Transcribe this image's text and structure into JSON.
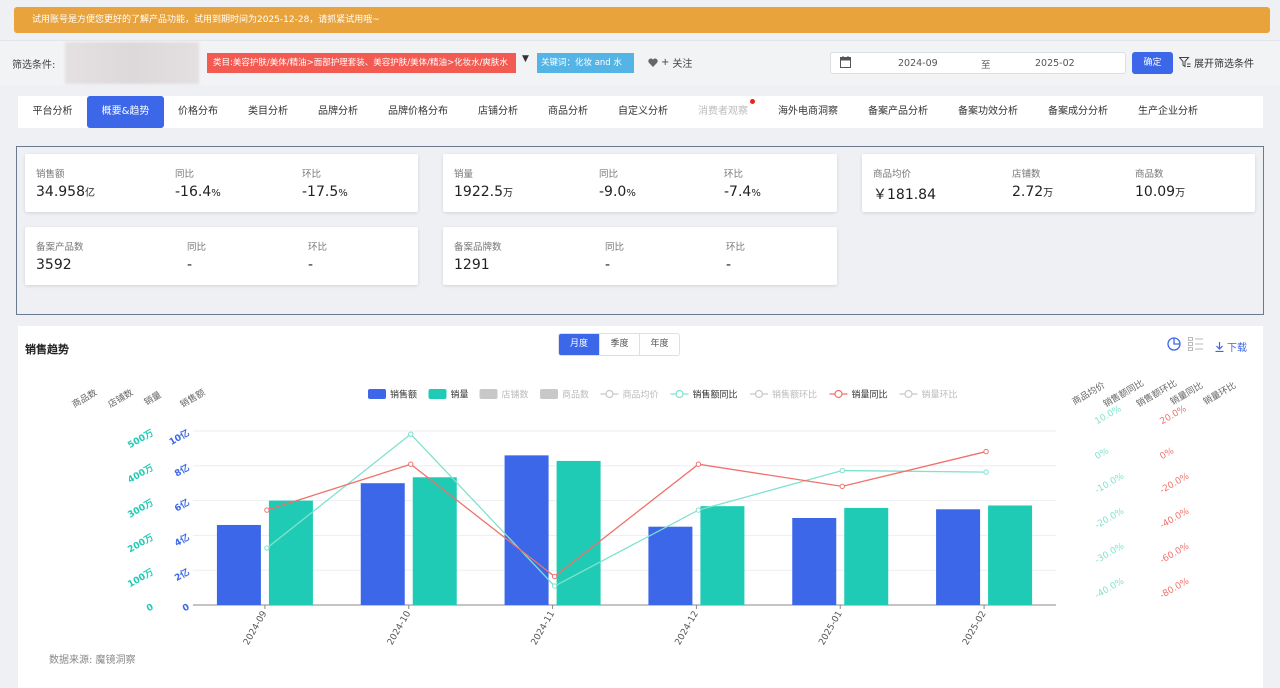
{
  "banner": {
    "text": "试用账号是方便您更好的了解产品功能，试用到期时间为2025-12-28，请抓紧试用哦~"
  },
  "filter": {
    "label": "筛选条件:",
    "category_tag": "类目:美容护肤/美体/精油>面部护理套装、美容护肤/美体/精油>化妆水/爽肤水",
    "keyword_tag": "关键词：化妆 and 水",
    "follow": "关注",
    "date_start": "2024-09",
    "date_sep": "至",
    "date_end": "2025-02",
    "confirm": "确定",
    "expand": "展开筛选条件"
  },
  "tabs": [
    "平台分析",
    "概要&趋势",
    "价格分布",
    "类目分析",
    "品牌分析",
    "品牌价格分布",
    "店铺分析",
    "商品分析",
    "自定义分析",
    "消费者观察",
    "海外电商洞察",
    "备案产品分析",
    "备案功效分析",
    "备案成分分析",
    "生产企业分析"
  ],
  "active_tab": "概要&趋势",
  "kpi": {
    "sales_amount": {
      "label": "销售额",
      "value": "34.958",
      "unit": "亿"
    },
    "sales_amount_yoy": {
      "label": "同比",
      "value": "-16.4",
      "unit": "%"
    },
    "sales_amount_mom": {
      "label": "环比",
      "value": "-17.5",
      "unit": "%"
    },
    "sales_volume": {
      "label": "销量",
      "value": "1922.5",
      "unit": "万"
    },
    "sales_volume_yoy": {
      "label": "同比",
      "value": "-9.0",
      "unit": "%"
    },
    "sales_volume_mom": {
      "label": "环比",
      "value": "-7.4",
      "unit": "%"
    },
    "avg_price": {
      "label": "商品均价",
      "value": "￥181.84",
      "unit": ""
    },
    "shops": {
      "label": "店铺数",
      "value": "2.72",
      "unit": "万"
    },
    "products": {
      "label": "商品数",
      "value": "10.09",
      "unit": "万"
    },
    "filed_products": {
      "label": "备案产品数",
      "value": "3592",
      "unit": ""
    },
    "filed_products_yoy": {
      "label": "同比",
      "value": "-",
      "unit": ""
    },
    "filed_products_mom": {
      "label": "环比",
      "value": "-",
      "unit": ""
    },
    "filed_brands": {
      "label": "备案品牌数",
      "value": "1291",
      "unit": ""
    },
    "filed_brands_yoy": {
      "label": "同比",
      "value": "-",
      "unit": ""
    },
    "filed_brands_mom": {
      "label": "环比",
      "value": "-",
      "unit": ""
    }
  },
  "chart_section": {
    "title": "销售趋势",
    "periods": [
      "月度",
      "季度",
      "年度"
    ],
    "active_period": "月度",
    "download": "下载",
    "source": "数据来源: 魔镜洞察"
  },
  "colors": {
    "blue": "#3b67e8",
    "teal": "#20cbb5",
    "red": "#f0716b",
    "mint": "#7fe2cf",
    "grey": "#c8c8c8",
    "accent": "#3b67e8",
    "banner": "#e8a33d"
  },
  "chart_data": {
    "type": "bar",
    "categories": [
      "2024-09",
      "2024-10",
      "2024-11",
      "2024-12",
      "2025-01",
      "2025-02"
    ],
    "legend": [
      {
        "name": "销售额",
        "kind": "bar",
        "color": "#3b67e8",
        "active": true
      },
      {
        "name": "销量",
        "kind": "bar",
        "color": "#20cbb5",
        "active": true
      },
      {
        "name": "店铺数",
        "kind": "bar",
        "color": "#c8c8c8",
        "active": false
      },
      {
        "name": "商品数",
        "kind": "bar",
        "color": "#c8c8c8",
        "active": false
      },
      {
        "name": "商品均价",
        "kind": "line",
        "color": "#c8c8c8",
        "active": false
      },
      {
        "name": "销售额同比",
        "kind": "line",
        "color": "#7fe2cf",
        "active": true
      },
      {
        "name": "销售额环比",
        "kind": "line",
        "color": "#c8c8c8",
        "active": false
      },
      {
        "name": "销量同比",
        "kind": "line",
        "color": "#f0716b",
        "active": true
      },
      {
        "name": "销量环比",
        "kind": "line",
        "color": "#c8c8c8",
        "active": false
      }
    ],
    "left_axis_titles": [
      "商品数",
      "店铺数",
      "销量",
      "销售额"
    ],
    "right_axis_titles": [
      "商品均价",
      "销售额同比",
      "销售额环比",
      "销量同比",
      "销量环比"
    ],
    "series": [
      {
        "name": "销售额",
        "unit": "亿",
        "axis": "sales",
        "values": [
          4.6,
          7.0,
          8.6,
          4.5,
          5.0,
          5.5
        ]
      },
      {
        "name": "销量",
        "unit": "万",
        "axis": "volume",
        "values": [
          300,
          367,
          414,
          284,
          279,
          286
        ]
      },
      {
        "name": "销售额同比",
        "unit": "%",
        "axis": "yoy_amount",
        "values": [
          -27,
          9,
          -39,
          -15,
          -2.5,
          -3
        ]
      },
      {
        "name": "销量同比",
        "unit": "%",
        "axis": "yoy_volume",
        "values": [
          -30,
          -1,
          -72,
          -1,
          -15,
          7
        ]
      }
    ],
    "axes": {
      "sales": {
        "ticks": [
          "0",
          "2亿",
          "4亿",
          "6亿",
          "8亿",
          "10亿"
        ],
        "range": [
          0,
          10
        ]
      },
      "volume": {
        "ticks": [
          "0",
          "100万",
          "200万",
          "300万",
          "400万",
          "500万"
        ],
        "range": [
          0,
          500
        ]
      },
      "yoy_amount": {
        "ticks": [
          "-40.0%",
          "-30.0%",
          "-20.0%",
          "-10.0%",
          "0%",
          "10.0%"
        ],
        "range": [
          -45,
          10
        ]
      },
      "yoy_volume": {
        "ticks": [
          "-80.0%",
          "-60.0%",
          "-40.0%",
          "-20.0%",
          "0%",
          "20.0%"
        ],
        "range": [
          -90,
          20
        ]
      }
    }
  }
}
